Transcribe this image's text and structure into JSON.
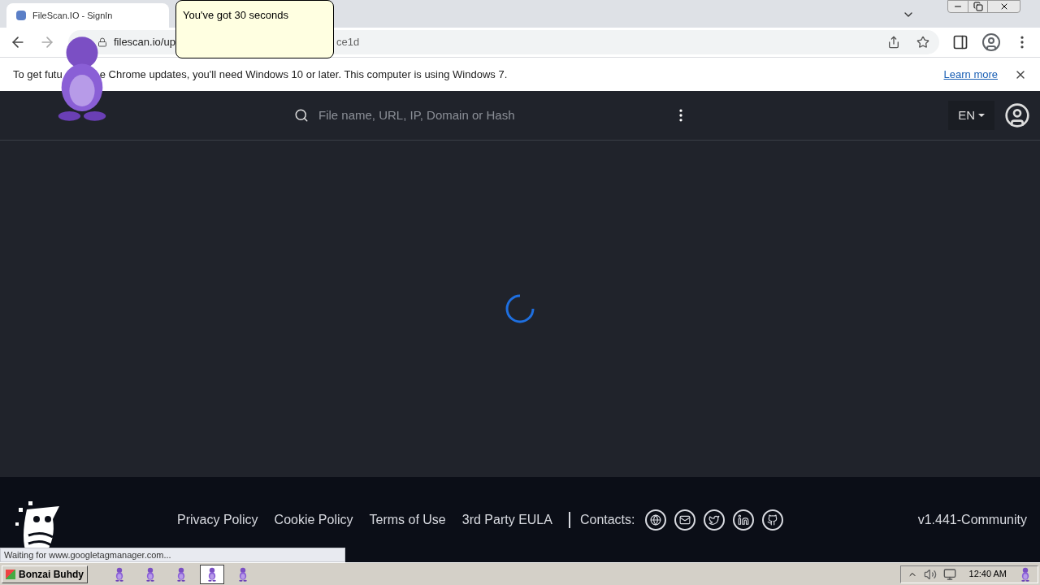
{
  "browser": {
    "tab_title": "FileScan.IO - SignIn",
    "url_parts": [
      "filescan.io/up",
      "ce1d"
    ]
  },
  "infobar": {
    "message_parts": [
      "To get futu",
      "e Chrome updates, you'll need Windows 10 or later. This computer is using Windows 7."
    ],
    "link": "Learn more"
  },
  "speech_bubble": "You've got 30 seconds",
  "header": {
    "search_placeholder": "File name, URL, IP, Domain or Hash",
    "language": "EN"
  },
  "footer": {
    "links": [
      "Privacy Policy",
      "Cookie Policy",
      "Terms of Use",
      "3rd Party EULA"
    ],
    "contacts_label": "Contacts:",
    "contacts": [
      {
        "kind": "globe"
      },
      {
        "kind": "mail"
      },
      {
        "kind": "twitter"
      },
      {
        "kind": "linkedin"
      },
      {
        "kind": "github"
      }
    ],
    "version": "v1.441-Community"
  },
  "status_text": "Waiting for www.googletagmanager.com...",
  "taskbar": {
    "start_label": "Bonzai Buhdy",
    "items": [
      {
        "selected": false
      },
      {
        "selected": false
      },
      {
        "selected": false
      },
      {
        "selected": true
      },
      {
        "selected": false
      }
    ],
    "clock": "12:40 AM"
  }
}
